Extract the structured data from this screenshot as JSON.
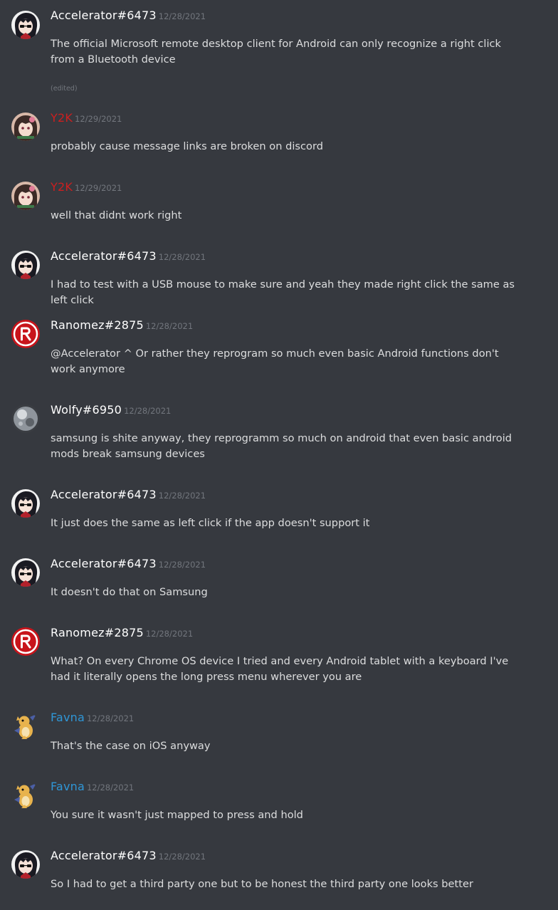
{
  "colors": {
    "background": "#36393f",
    "text": "#dcddde",
    "muted": "#72767d",
    "username_default": "#ffffff",
    "username_red": "#cc1f1f",
    "username_blue": "#2f96d6"
  },
  "messages": [
    {
      "user": "Accelerator#6473",
      "timestamp": "12/28/2021",
      "text": "The official Microsoft remote desktop client for Android can only recognize a right click from a Bluetooth device",
      "edited_label": "(edited)",
      "avatar": "anime-avatar-icon",
      "name_color": "#ffffff"
    },
    {
      "user": "Y2K",
      "timestamp": "12/29/2021",
      "text": "probably cause message links are broken on discord",
      "avatar": "anime-girl-avatar-icon",
      "name_color": "#cc1f1f"
    },
    {
      "user": "Y2K",
      "timestamp": "12/29/2021",
      "text": "well that didnt work right",
      "avatar": "anime-girl-avatar-icon",
      "name_color": "#cc1f1f"
    },
    {
      "user": "Accelerator#6473",
      "timestamp": "12/28/2021",
      "text": "I had to test with a USB mouse to make sure and yeah they made right click the same as left click",
      "avatar": "anime-avatar-icon",
      "name_color": "#ffffff"
    },
    {
      "user": "Ranomez#2875",
      "timestamp": "12/28/2021",
      "text": "@Accelerator ^ Or rather they reprogram so much even basic Android functions don't work anymore",
      "avatar": "red-r-logo-avatar-icon",
      "name_color": "#ffffff"
    },
    {
      "user": "Wolfy#6950",
      "timestamp": "12/28/2021",
      "text": "samsung is shite anyway, they reprogramm so much on android that even basic android mods break samsung devices",
      "avatar": "grey-orb-avatar-icon",
      "name_color": "#ffffff"
    },
    {
      "user": "Accelerator#6473",
      "timestamp": "12/28/2021",
      "text": "It just does the same as left click if the app doesn't support it",
      "avatar": "anime-avatar-icon",
      "name_color": "#ffffff"
    },
    {
      "user": "Accelerator#6473",
      "timestamp": "12/28/2021",
      "text": "It doesn't do that on Samsung",
      "avatar": "anime-avatar-icon",
      "name_color": "#ffffff"
    },
    {
      "user": "Ranomez#2875",
      "timestamp": "12/28/2021",
      "text": "What? On every Chrome OS device I tried and every Android tablet with a keyboard I've had it literally opens the long press menu wherever you are",
      "avatar": "red-r-logo-avatar-icon",
      "name_color": "#ffffff"
    },
    {
      "user": "Favna",
      "timestamp": "12/28/2021",
      "text": "That's the case on iOS anyway",
      "avatar": "dragon-avatar-icon",
      "name_color": "#2f96d6"
    },
    {
      "user": "Favna",
      "timestamp": "12/28/2021",
      "text": "You sure it wasn't just mapped to press and hold",
      "avatar": "dragon-avatar-icon",
      "name_color": "#2f96d6"
    },
    {
      "user": "Accelerator#6473",
      "timestamp": "12/28/2021",
      "text": "So I had to get a third party one but to be honest the third party one looks better",
      "avatar": "anime-avatar-icon",
      "name_color": "#ffffff"
    }
  ]
}
